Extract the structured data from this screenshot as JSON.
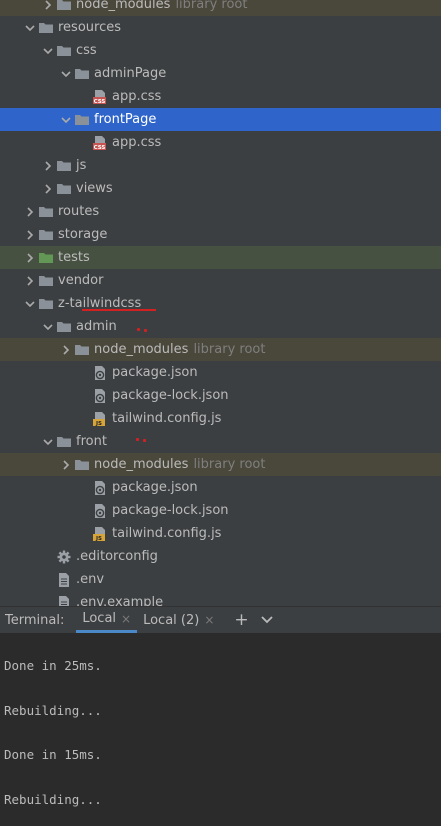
{
  "tree": [
    {
      "indent": 3,
      "arrow": "right",
      "icon": "folder",
      "label": "node_modules",
      "tag": "library root",
      "highlight": "lib"
    },
    {
      "indent": 2,
      "arrow": "down",
      "icon": "folder",
      "label": "resources"
    },
    {
      "indent": 3,
      "arrow": "down",
      "icon": "folder",
      "label": "css"
    },
    {
      "indent": 4,
      "arrow": "down",
      "icon": "folder",
      "label": "adminPage"
    },
    {
      "indent": 5,
      "arrow": "",
      "icon": "css",
      "label": "app.css"
    },
    {
      "indent": 4,
      "arrow": "down",
      "icon": "folder",
      "label": "frontPage",
      "highlight": "sel"
    },
    {
      "indent": 5,
      "arrow": "",
      "icon": "css",
      "label": "app.css"
    },
    {
      "indent": 3,
      "arrow": "right",
      "icon": "folder",
      "label": "js"
    },
    {
      "indent": 3,
      "arrow": "right",
      "icon": "folder",
      "label": "views"
    },
    {
      "indent": 2,
      "arrow": "right",
      "icon": "folder",
      "label": "routes"
    },
    {
      "indent": 2,
      "arrow": "right",
      "icon": "folder",
      "label": "storage"
    },
    {
      "indent": 2,
      "arrow": "right",
      "icon": "folder-green",
      "label": "tests",
      "highlight": "test"
    },
    {
      "indent": 2,
      "arrow": "right",
      "icon": "folder",
      "label": "vendor"
    },
    {
      "indent": 2,
      "arrow": "down",
      "icon": "folder",
      "label": "z-tailwindcss"
    },
    {
      "indent": 3,
      "arrow": "down",
      "icon": "folder",
      "label": "admin"
    },
    {
      "indent": 4,
      "arrow": "right",
      "icon": "folder",
      "label": "node_modules",
      "tag": "library root",
      "highlight": "lib"
    },
    {
      "indent": 5,
      "arrow": "",
      "icon": "json",
      "label": "package.json"
    },
    {
      "indent": 5,
      "arrow": "",
      "icon": "json",
      "label": "package-lock.json"
    },
    {
      "indent": 5,
      "arrow": "",
      "icon": "js",
      "label": "tailwind.config.js"
    },
    {
      "indent": 3,
      "arrow": "down",
      "icon": "folder",
      "label": "front"
    },
    {
      "indent": 4,
      "arrow": "right",
      "icon": "folder",
      "label": "node_modules",
      "tag": "library root",
      "highlight": "lib"
    },
    {
      "indent": 5,
      "arrow": "",
      "icon": "json",
      "label": "package.json"
    },
    {
      "indent": 5,
      "arrow": "",
      "icon": "json",
      "label": "package-lock.json"
    },
    {
      "indent": 5,
      "arrow": "",
      "icon": "js",
      "label": "tailwind.config.js"
    },
    {
      "indent": 3,
      "arrow": "",
      "icon": "gear",
      "label": ".editorconfig"
    },
    {
      "indent": 3,
      "arrow": "",
      "icon": "file",
      "label": ".env"
    },
    {
      "indent": 3,
      "arrow": "",
      "icon": "file",
      "label": ".env.example"
    }
  ],
  "terminal": {
    "title": "Terminal:",
    "tabs": [
      {
        "label": "Local",
        "active": true
      },
      {
        "label": "Local (2)",
        "active": false
      }
    ],
    "close_glyph": "×",
    "add_glyph": "+",
    "menu_glyph": "⌄",
    "lines": [
      "Done in 25ms.",
      "Rebuilding...",
      "Done in 15ms.",
      "Rebuilding..."
    ]
  },
  "colors": {
    "accent": "#2f65ca",
    "annotation": "#d42020",
    "folder": "#8a9199",
    "tests_folder": "#629755"
  }
}
